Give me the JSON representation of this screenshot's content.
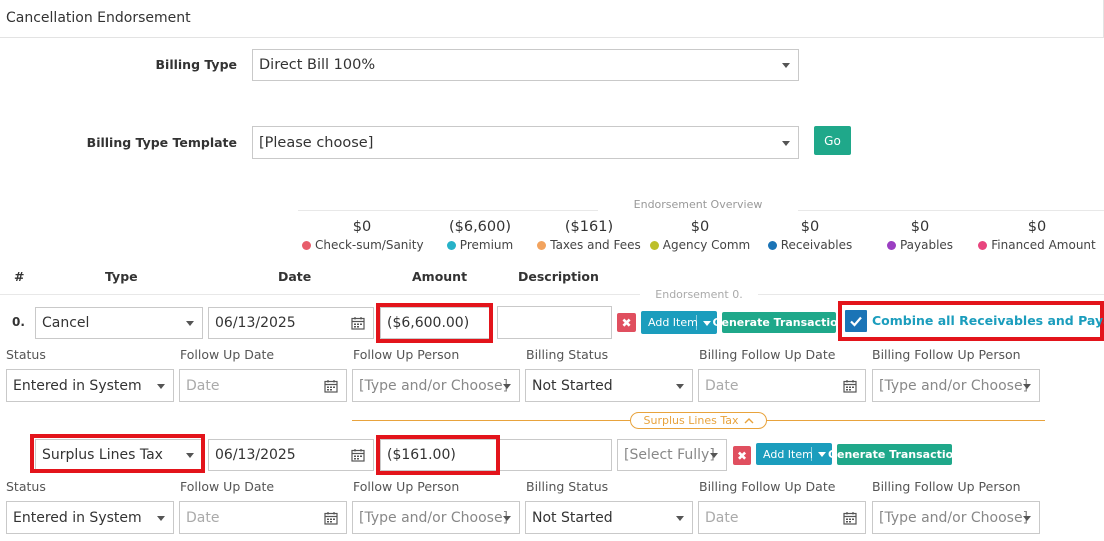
{
  "header": {
    "title": "Cancellation Endorsement"
  },
  "billing": {
    "type_label": "Billing Type",
    "type_value": "Direct Bill 100%",
    "template_label": "Billing Type Template",
    "template_value": "[Please choose]",
    "go_label": "Go"
  },
  "overview": {
    "title": "Endorsement Overview",
    "items": [
      {
        "value": "$0",
        "label": "Check-sum/Sanity",
        "color": "#e85d6b"
      },
      {
        "value": "($6,600)",
        "label": "Premium",
        "color": "#27b2c8"
      },
      {
        "value": "($161)",
        "label": "Taxes and Fees",
        "color": "#f2a35e"
      },
      {
        "value": "$0",
        "label": "Agency Comm",
        "color": "#bdbf2c"
      },
      {
        "value": "$0",
        "label": "Receivables",
        "color": "#1b74b6"
      },
      {
        "value": "$0",
        "label": "Payables",
        "color": "#9b3fc2"
      },
      {
        "value": "$0",
        "label": "Financed Amount",
        "color": "#e8457e"
      }
    ]
  },
  "columns": {
    "num": "#",
    "type": "Type",
    "date": "Date",
    "amount": "Amount",
    "description": "Description"
  },
  "endorsement_label": "Endorsement 0.",
  "row": {
    "index": "0.",
    "type": "Cancel",
    "date": "06/13/2025",
    "amount": "($6,600.00)",
    "description": "",
    "add_item": "Add Item",
    "generate": "Generate Transaction",
    "combine_label": "Combine all Receivables and Payables",
    "combine_checked": true
  },
  "status_labels": {
    "status": "Status",
    "follow_up_date": "Follow Up Date",
    "follow_up_person": "Follow Up Person",
    "billing_status": "Billing Status",
    "billing_follow_up_date": "Billing Follow Up Date",
    "billing_follow_up_person": "Billing Follow Up Person"
  },
  "status_row_1": {
    "status": "Entered in System",
    "follow_up_date_placeholder": "Date",
    "follow_up_person_placeholder": "[Type and/or Choose]",
    "billing_status": "Not Started",
    "billing_follow_up_date_placeholder": "Date",
    "billing_follow_up_person_placeholder": "[Type and/or Choose]"
  },
  "surplus_tag": "Surplus Lines Tax",
  "sub_row": {
    "type": "Surplus Lines Tax",
    "date": "06/13/2025",
    "amount": "($161.00)",
    "select_placeholder": "[Select Fully]",
    "add_item": "Add Item",
    "generate": "Generate Transaction"
  },
  "status_row_2": {
    "status": "Entered in System",
    "follow_up_date_placeholder": "Date",
    "follow_up_person_placeholder": "[Type and/or Choose]",
    "billing_status": "Not Started",
    "billing_follow_up_date_placeholder": "Date",
    "billing_follow_up_person_placeholder": "[Type and/or Choose]"
  }
}
